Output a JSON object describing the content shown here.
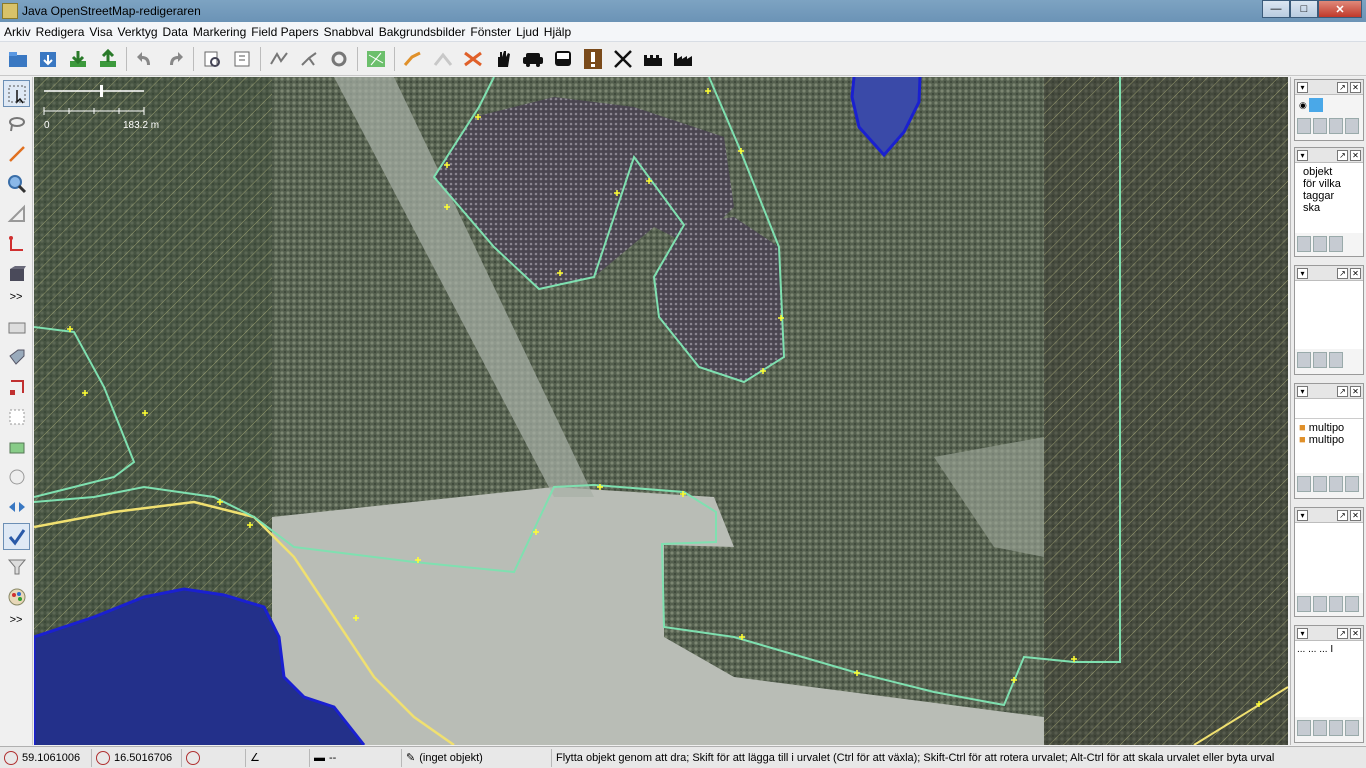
{
  "window": {
    "title": "Java OpenStreetMap-redigeraren"
  },
  "menu": [
    "Arkiv",
    "Redigera",
    "Visa",
    "Verktyg",
    "Data",
    "Markering",
    "Field Papers",
    "Snabbval",
    "Bakgrundsbilder",
    "Fönster",
    "Ljud",
    "Hjälp"
  ],
  "toolbar_icons": [
    "open-icon",
    "save-icon",
    "download-icon",
    "upload-icon",
    "undo-icon",
    "redo-icon",
    "preferences-icon",
    "tag-icon",
    "wireframe-icon",
    "split-icon",
    "refresh-icon",
    "map-icon",
    "draw-icon",
    "merge-icon",
    "delete-icon",
    "hand-icon",
    "car-icon",
    "bus-icon",
    "warning-icon",
    "restaurant-icon",
    "castle-icon",
    "factory-icon"
  ],
  "left_tools": {
    "more_label_1": ">>",
    "more_label_2": ">>"
  },
  "map": {
    "scale_min": "0",
    "scale_max": "183.2 m"
  },
  "dialogs": {
    "tags_text": [
      "objekt",
      "för vilka",
      "taggar",
      "ska"
    ],
    "relations": [
      "multipo",
      "multipo"
    ],
    "search_text": "... ... ... I"
  },
  "status": {
    "lat": "59.1061006",
    "lon": "16.5016706",
    "heading": "",
    "angle": "",
    "distance": "--",
    "selection": "(inget objekt)",
    "help": "Flytta objekt genom att dra; Skift för att lägga till i urvalet (Ctrl för att växla); Skift-Ctrl för att rotera urvalet; Alt-Ctrl för att skala urvalet eller byta urval"
  },
  "colors": {
    "area_outline": "#7fe0b0",
    "water": "#1a20d0",
    "road": "#f0e070",
    "node": "#ffff33"
  }
}
